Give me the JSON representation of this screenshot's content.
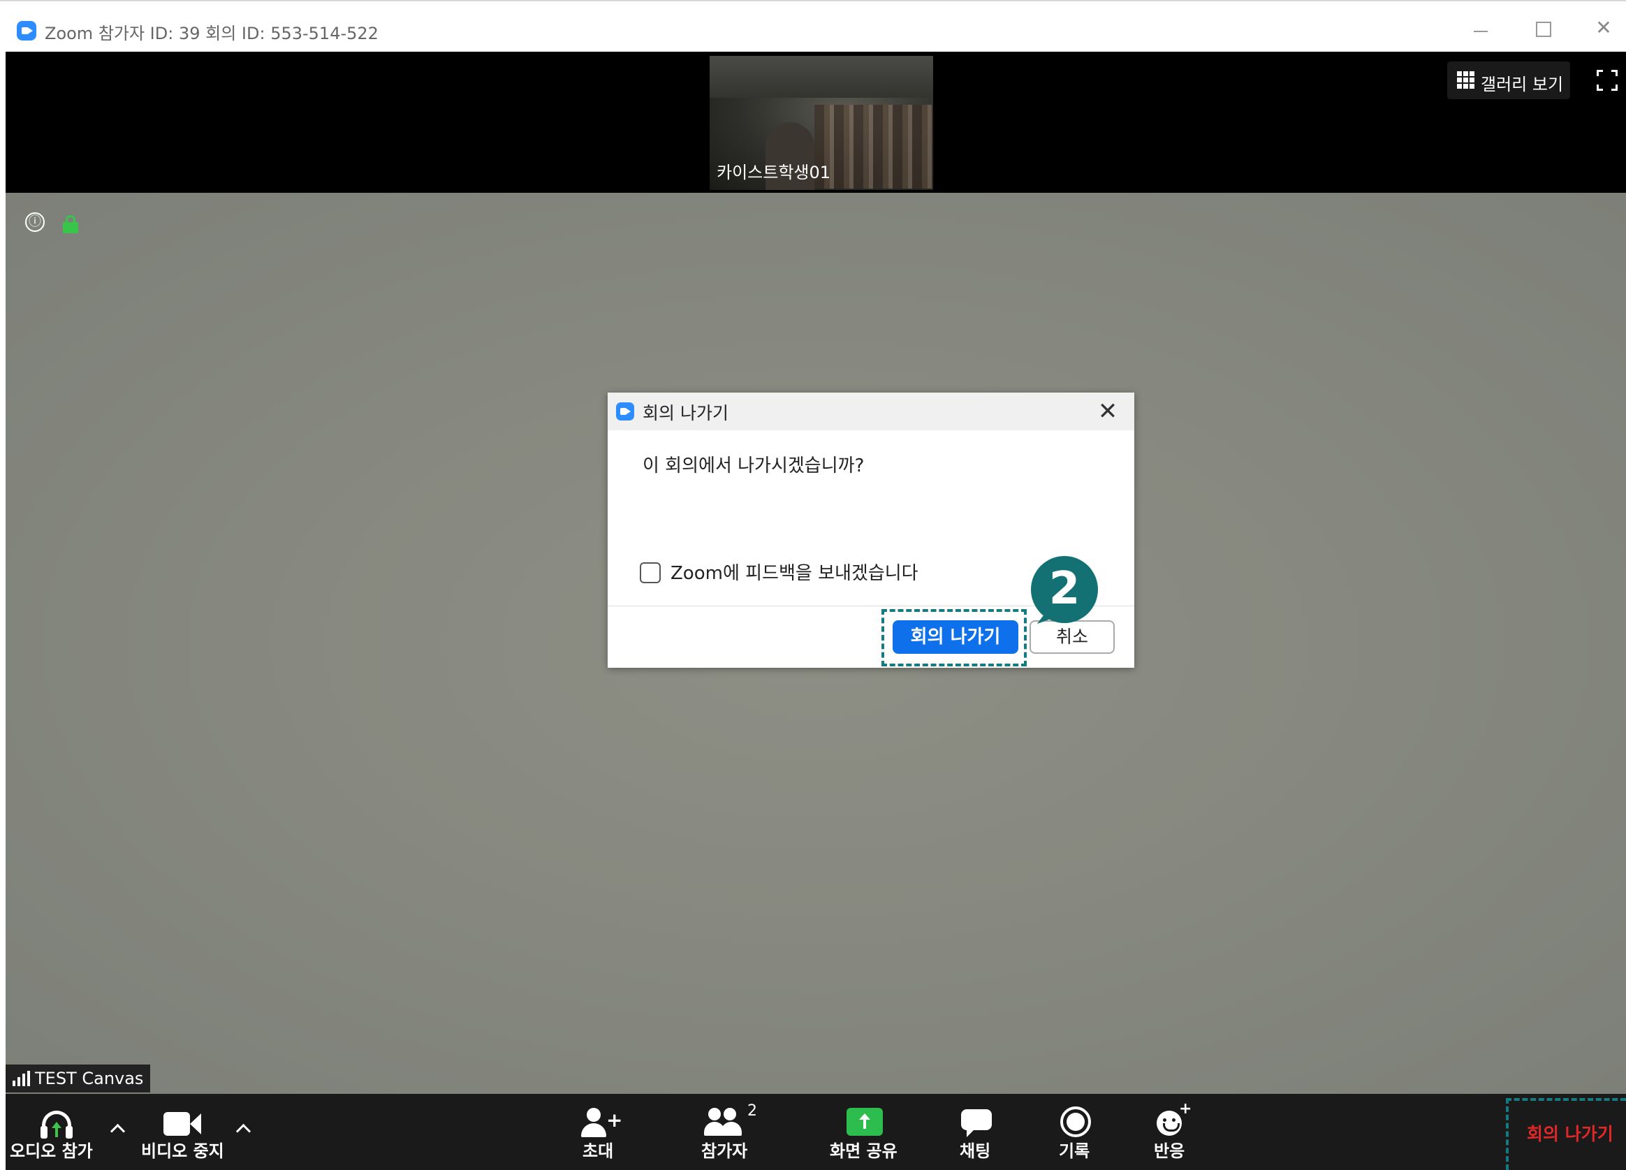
{
  "window": {
    "title": "Zoom 참가자 ID: 39   회의 ID: 553-514-522",
    "controls": {
      "minimize_icon": "minimize-icon",
      "maximize_icon": "maximize-icon",
      "close": "✕"
    }
  },
  "top_strip": {
    "participant_thumbnail_name": "카이스트학생01",
    "gallery_view_label": "갤러리 보기",
    "fullscreen_icon": "fullscreen-icon"
  },
  "main_video": {
    "info_icon": "ⓘ",
    "lock_icon": "lock-icon",
    "name_tag": "TEST Canvas"
  },
  "dialog": {
    "title": "회의 나가기",
    "close": "✕",
    "message": "이 회의에서 나가시겠습니까?",
    "feedback_checkbox_label": "Zoom에 피드백을 보내겠습니다",
    "feedback_checked": false,
    "leave_button": "회의 나가기",
    "cancel_button": "취소"
  },
  "annotation": {
    "step_number": "2",
    "highlight_color": "#167b80"
  },
  "toolbar": {
    "join_audio": "오디오 참가",
    "stop_video": "비디오 중지",
    "invite": "초대",
    "participants": "참가자",
    "participants_count": "2",
    "share_screen": "화면 공유",
    "chat": "채팅",
    "record": "기록",
    "reactions": "반응",
    "end": "회의 나가기",
    "end_color": "#e02828",
    "share_color": "#2dbd4e"
  },
  "colors": {
    "zoom_blue": "#2d8cff",
    "primary_button": "#0e71eb",
    "lock_green": "#39c54a"
  }
}
